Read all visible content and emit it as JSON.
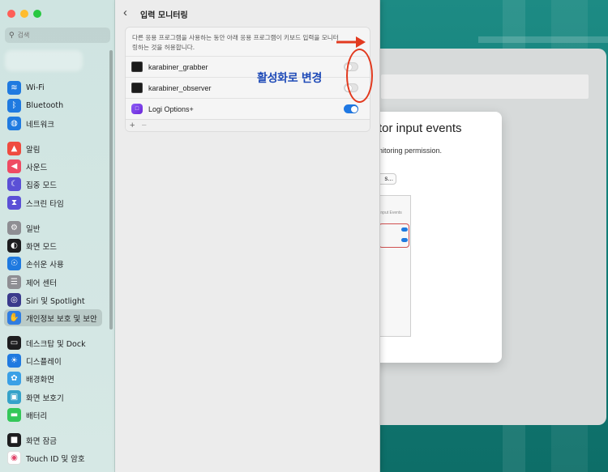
{
  "colors": {
    "accent": "#1f78e3",
    "annotation_red": "#e23a1f",
    "annotation_blue": "#1f4bb8",
    "desktop": "#13807a"
  },
  "sidebar": {
    "search_placeholder": "검색",
    "items": [
      {
        "label": "Wi-Fi",
        "icon": "wifi-icon",
        "icon_color": "#1f7ae0"
      },
      {
        "label": "Bluetooth",
        "icon": "bluetooth-icon",
        "icon_color": "#1f7ae0"
      },
      {
        "label": "네트워크",
        "icon": "globe-icon",
        "icon_color": "#1f7ae0"
      },
      {
        "label": "알림",
        "icon": "bell-icon",
        "icon_color": "#ef4b3f"
      },
      {
        "label": "사운드",
        "icon": "speaker-icon",
        "icon_color": "#ef4b63"
      },
      {
        "label": "집중 모드",
        "icon": "moon-icon",
        "icon_color": "#5b50d6"
      },
      {
        "label": "스크린 타임",
        "icon": "hourglass-icon",
        "icon_color": "#5b50d6"
      },
      {
        "label": "일반",
        "icon": "gear-icon",
        "icon_color": "#8e8e93"
      },
      {
        "label": "화면 모드",
        "icon": "appearance-icon",
        "icon_color": "#1d1d1f"
      },
      {
        "label": "손쉬운 사용",
        "icon": "accessibility-icon",
        "icon_color": "#1f7ae0"
      },
      {
        "label": "제어 센터",
        "icon": "control-center-icon",
        "icon_color": "#8e8e93"
      },
      {
        "label": "Siri 및 Spotlight",
        "icon": "siri-icon",
        "icon_color": "#3a3a8c"
      },
      {
        "label": "개인정보 보호 및 보안",
        "icon": "hand-icon",
        "icon_color": "#2f7de1",
        "selected": true
      },
      {
        "label": "데스크탑 및 Dock",
        "icon": "dock-icon",
        "icon_color": "#1d1d1f"
      },
      {
        "label": "디스플레이",
        "icon": "sun-icon",
        "icon_color": "#1f7ae0"
      },
      {
        "label": "배경화면",
        "icon": "flower-icon",
        "icon_color": "#3aa0e6"
      },
      {
        "label": "화면 보호기",
        "icon": "screensaver-icon",
        "icon_color": "#36a2c9"
      },
      {
        "label": "배터리",
        "icon": "battery-icon",
        "icon_color": "#34c759"
      },
      {
        "label": "화면 잠금",
        "icon": "lock-icon",
        "icon_color": "#1d1d1f"
      },
      {
        "label": "Touch ID 및 암호",
        "icon": "fingerprint-icon",
        "icon_color": "#ffffff"
      }
    ]
  },
  "main": {
    "title": "입력 모니터링",
    "description": "다른 응용 프로그램을 사용하는 동안 아래 응용 프로그램이 키보드 입력을 모니터링하는 것을 허용합니다.",
    "apps": [
      {
        "name": "karabiner_grabber",
        "icon": "terminal-icon",
        "enabled": false
      },
      {
        "name": "karabiner_observer",
        "icon": "terminal-icon",
        "enabled": false
      },
      {
        "name": "Logi Options+",
        "icon": "logi-options-icon",
        "enabled": true
      }
    ],
    "add_label": "+",
    "remove_label": "−"
  },
  "annotation": {
    "text": "활성화로 변경"
  },
  "background_dialog": {
    "title": "tor input events",
    "subtitle": "nitoring permission.",
    "button": "s..."
  }
}
